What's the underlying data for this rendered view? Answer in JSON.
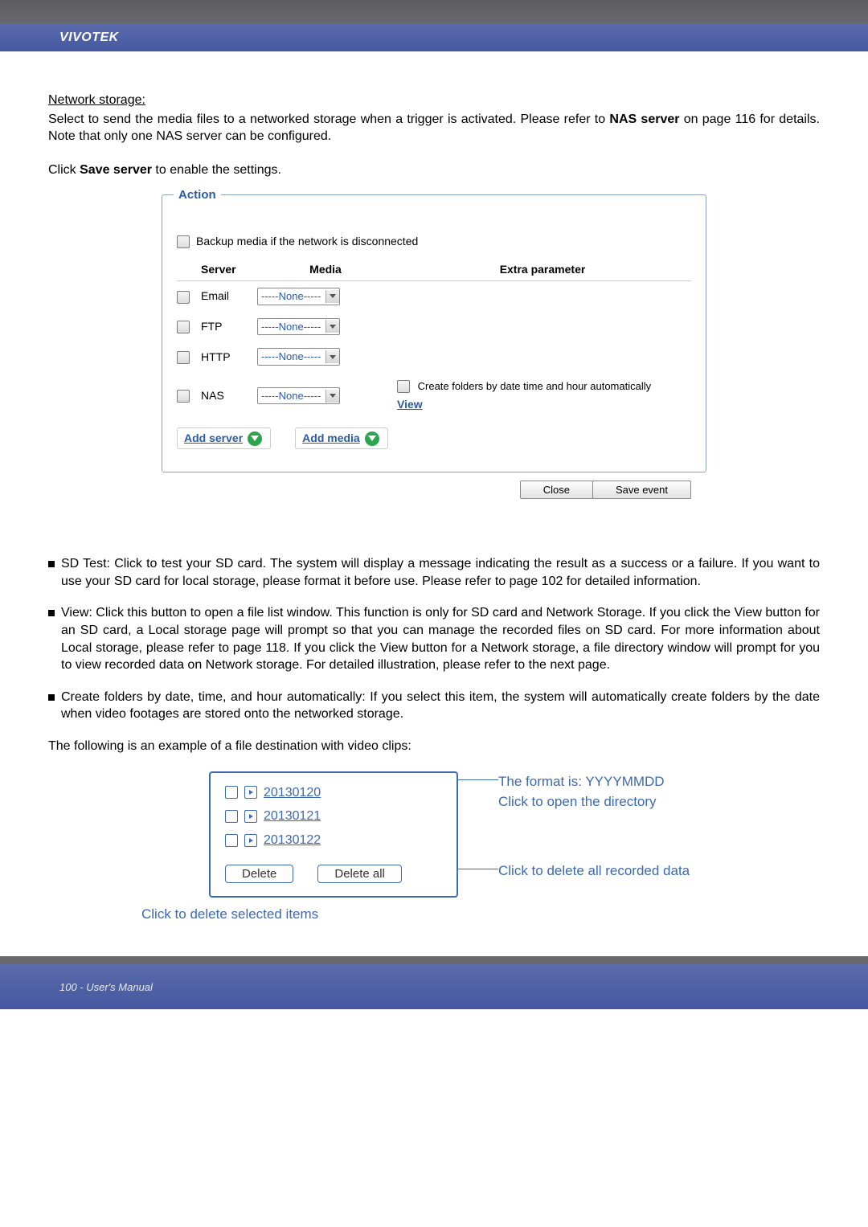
{
  "header": {
    "brand": "VIVOTEK"
  },
  "sections": {
    "net_storage_title": "Network storage:",
    "net_storage_p1a": "Select to send the media files to a networked storage when a trigger is activated. Please refer to ",
    "net_storage_p1b_bold": "NAS server",
    "net_storage_p1c": " on page 116 for details. Note that only one NAS server can be configured.",
    "click_save_a": "Click ",
    "click_save_b_bold": "Save server",
    "click_save_c": " to enable the settings."
  },
  "action_panel": {
    "legend": "Action",
    "backup_label": "Backup media if the network is disconnected",
    "head_server": "Server",
    "head_media": "Media",
    "head_extra": "Extra parameter",
    "rows": [
      {
        "name": "Email",
        "media": "-----None-----"
      },
      {
        "name": "FTP",
        "media": "-----None-----"
      },
      {
        "name": "HTTP",
        "media": "-----None-----"
      },
      {
        "name": "NAS",
        "media": "-----None-----"
      }
    ],
    "nas_create": "Create folders by date time and hour automatically",
    "nas_view": "View",
    "add_server": "Add server",
    "add_media": "Add media",
    "close_btn": "Close",
    "save_event_btn": "Save event"
  },
  "bullets": {
    "sd": "SD Test: Click to test your SD card. The system will display a message indicating the result as a success or a failure. If you want to use your SD card for local storage, please format it before use. Please refer to page 102 for detailed information.",
    "view": "View: Click this button to open a file list window. This function is only for SD card and Network Storage. If you click the View button for an SD card, a Local storage page will prompt so that you can manage the recorded files on SD card. For more information about Local storage, please refer to page 118. If you click the View button for a Network storage, a file directory window will prompt for you to view recorded data on Network storage. For detailed illustration, please refer to the next page.",
    "create": "Create folders by date, time, and hour automatically: If you select this item, the system will automatically create folders by the date when video footages are stored onto the networked storage."
  },
  "example": {
    "intro": "The following is an example of a file destination with video clips:",
    "folders": [
      "20130120",
      "20130121",
      "20130122"
    ],
    "delete": "Delete",
    "delete_all": "Delete all",
    "note_format": "The format is: YYYYMMDD",
    "note_open": "Click to open the directory",
    "note_del_all": "Click to delete all recorded data",
    "note_del_sel": "Click to delete selected items"
  },
  "footer": {
    "text": "100 - User's Manual"
  }
}
